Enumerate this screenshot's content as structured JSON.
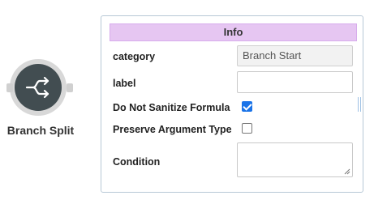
{
  "node": {
    "label": "Branch Split",
    "icon": "branch-split-icon"
  },
  "inspector": {
    "header": "Info",
    "rows": {
      "category": {
        "label": "category",
        "value": "Branch Start"
      },
      "label": {
        "label": "label",
        "value": ""
      },
      "do_not_sanitize": {
        "label": "Do Not Sanitize Formula",
        "checked": true
      },
      "preserve_argument_type": {
        "label": "Preserve Argument Type",
        "checked": false
      },
      "condition": {
        "label": "Condition",
        "value": ""
      }
    }
  },
  "colors": {
    "header_bg": "#e6c6f2",
    "node_fill": "#424d51",
    "panel_border": "#b7c8d6",
    "checkbox_accent": "#1a73e8"
  }
}
